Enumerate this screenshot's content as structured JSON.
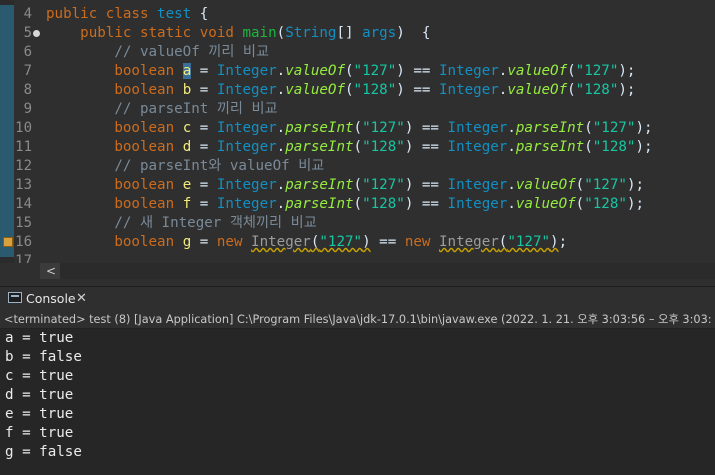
{
  "editor": {
    "lines": [
      {
        "num": "4",
        "tokens": [
          {
            "t": "public class ",
            "c": "kw"
          },
          {
            "t": "test ",
            "c": "ty"
          },
          {
            "t": "{",
            "c": ""
          }
        ]
      },
      {
        "num": "5",
        "fold": true,
        "tokens": [
          {
            "t": "    ",
            "c": ""
          },
          {
            "t": "public static void ",
            "c": "kw"
          },
          {
            "t": "main",
            "c": "fn"
          },
          {
            "t": "(",
            "c": ""
          },
          {
            "t": "String",
            "c": "tp"
          },
          {
            "t": "[] ",
            "c": ""
          },
          {
            "t": "args",
            "c": "tp"
          },
          {
            "t": ")  {",
            "c": ""
          }
        ]
      },
      {
        "num": "6",
        "tokens": [
          {
            "t": "        // valueOf 끼리 비교",
            "c": "cm"
          }
        ]
      },
      {
        "num": "7",
        "tokens": [
          {
            "t": "        ",
            "c": ""
          },
          {
            "t": "boolean ",
            "c": "kw"
          },
          {
            "t": "a",
            "c": "va sel"
          },
          {
            "t": " = ",
            "c": ""
          },
          {
            "t": "Integer",
            "c": "tp"
          },
          {
            "t": ".",
            "c": ""
          },
          {
            "t": "valueOf",
            "c": "mi"
          },
          {
            "t": "(",
            "c": ""
          },
          {
            "t": "\"127\"",
            "c": "st"
          },
          {
            "t": ") == ",
            "c": ""
          },
          {
            "t": "Integer",
            "c": "tp"
          },
          {
            "t": ".",
            "c": ""
          },
          {
            "t": "valueOf",
            "c": "mi"
          },
          {
            "t": "(",
            "c": ""
          },
          {
            "t": "\"127\"",
            "c": "st"
          },
          {
            "t": ");",
            "c": ""
          }
        ]
      },
      {
        "num": "8",
        "tokens": [
          {
            "t": "        ",
            "c": ""
          },
          {
            "t": "boolean ",
            "c": "kw"
          },
          {
            "t": "b",
            "c": "va"
          },
          {
            "t": " = ",
            "c": ""
          },
          {
            "t": "Integer",
            "c": "tp"
          },
          {
            "t": ".",
            "c": ""
          },
          {
            "t": "valueOf",
            "c": "mi"
          },
          {
            "t": "(",
            "c": ""
          },
          {
            "t": "\"128\"",
            "c": "st"
          },
          {
            "t": ") == ",
            "c": ""
          },
          {
            "t": "Integer",
            "c": "tp"
          },
          {
            "t": ".",
            "c": ""
          },
          {
            "t": "valueOf",
            "c": "mi"
          },
          {
            "t": "(",
            "c": ""
          },
          {
            "t": "\"128\"",
            "c": "st"
          },
          {
            "t": ");",
            "c": ""
          }
        ]
      },
      {
        "num": "9",
        "tokens": [
          {
            "t": "        // parseInt 끼리 비교",
            "c": "cm"
          }
        ]
      },
      {
        "num": "10",
        "tokens": [
          {
            "t": "        ",
            "c": ""
          },
          {
            "t": "boolean ",
            "c": "kw"
          },
          {
            "t": "c",
            "c": "va"
          },
          {
            "t": " = ",
            "c": ""
          },
          {
            "t": "Integer",
            "c": "tp"
          },
          {
            "t": ".",
            "c": ""
          },
          {
            "t": "parseInt",
            "c": "mi"
          },
          {
            "t": "(",
            "c": ""
          },
          {
            "t": "\"127\"",
            "c": "st"
          },
          {
            "t": ") == ",
            "c": ""
          },
          {
            "t": "Integer",
            "c": "tp"
          },
          {
            "t": ".",
            "c": ""
          },
          {
            "t": "parseInt",
            "c": "mi"
          },
          {
            "t": "(",
            "c": ""
          },
          {
            "t": "\"127\"",
            "c": "st"
          },
          {
            "t": ");",
            "c": ""
          }
        ]
      },
      {
        "num": "11",
        "tokens": [
          {
            "t": "        ",
            "c": ""
          },
          {
            "t": "boolean ",
            "c": "kw"
          },
          {
            "t": "d",
            "c": "va"
          },
          {
            "t": " = ",
            "c": ""
          },
          {
            "t": "Integer",
            "c": "tp"
          },
          {
            "t": ".",
            "c": ""
          },
          {
            "t": "parseInt",
            "c": "mi"
          },
          {
            "t": "(",
            "c": ""
          },
          {
            "t": "\"128\"",
            "c": "st"
          },
          {
            "t": ") == ",
            "c": ""
          },
          {
            "t": "Integer",
            "c": "tp"
          },
          {
            "t": ".",
            "c": ""
          },
          {
            "t": "parseInt",
            "c": "mi"
          },
          {
            "t": "(",
            "c": ""
          },
          {
            "t": "\"128\"",
            "c": "st"
          },
          {
            "t": ");",
            "c": ""
          }
        ]
      },
      {
        "num": "12",
        "tokens": [
          {
            "t": "        // parseInt와 valueOf 비교",
            "c": "cm"
          }
        ]
      },
      {
        "num": "13",
        "tokens": [
          {
            "t": "        ",
            "c": ""
          },
          {
            "t": "boolean ",
            "c": "kw"
          },
          {
            "t": "e",
            "c": "va"
          },
          {
            "t": " = ",
            "c": ""
          },
          {
            "t": "Integer",
            "c": "tp"
          },
          {
            "t": ".",
            "c": ""
          },
          {
            "t": "parseInt",
            "c": "mi"
          },
          {
            "t": "(",
            "c": ""
          },
          {
            "t": "\"127\"",
            "c": "st"
          },
          {
            "t": ") == ",
            "c": ""
          },
          {
            "t": "Integer",
            "c": "tp"
          },
          {
            "t": ".",
            "c": ""
          },
          {
            "t": "valueOf",
            "c": "mi"
          },
          {
            "t": "(",
            "c": ""
          },
          {
            "t": "\"127\"",
            "c": "st"
          },
          {
            "t": ");",
            "c": ""
          }
        ]
      },
      {
        "num": "14",
        "tokens": [
          {
            "t": "        ",
            "c": ""
          },
          {
            "t": "boolean ",
            "c": "kw"
          },
          {
            "t": "f",
            "c": "va"
          },
          {
            "t": " = ",
            "c": ""
          },
          {
            "t": "Integer",
            "c": "tp"
          },
          {
            "t": ".",
            "c": ""
          },
          {
            "t": "parseInt",
            "c": "mi"
          },
          {
            "t": "(",
            "c": ""
          },
          {
            "t": "\"128\"",
            "c": "st"
          },
          {
            "t": ") == ",
            "c": ""
          },
          {
            "t": "Integer",
            "c": "tp"
          },
          {
            "t": ".",
            "c": ""
          },
          {
            "t": "valueOf",
            "c": "mi"
          },
          {
            "t": "(",
            "c": ""
          },
          {
            "t": "\"128\"",
            "c": "st"
          },
          {
            "t": ");",
            "c": ""
          }
        ]
      },
      {
        "num": "15",
        "tokens": [
          {
            "t": "        // 새 Integer 객체끼리 비교",
            "c": "cm"
          }
        ]
      },
      {
        "num": "16",
        "warning": true,
        "tokens": [
          {
            "t": "        ",
            "c": ""
          },
          {
            "t": "boolean ",
            "c": "kw"
          },
          {
            "t": "g",
            "c": "va"
          },
          {
            "t": " = ",
            "c": ""
          },
          {
            "t": "new ",
            "c": "kw"
          },
          {
            "t": "Integer",
            "c": "depr warn"
          },
          {
            "t": "(",
            "c": "warn"
          },
          {
            "t": "\"127\"",
            "c": "st warn"
          },
          {
            "t": ")",
            "c": "warn"
          },
          {
            "t": " == ",
            "c": ""
          },
          {
            "t": "new ",
            "c": "kw"
          },
          {
            "t": "Integer",
            "c": "depr warn"
          },
          {
            "t": "(",
            "c": "warn"
          },
          {
            "t": "\"127\"",
            "c": "st warn"
          },
          {
            "t": ")",
            "c": "warn"
          },
          {
            "t": ";",
            "c": ""
          }
        ]
      },
      {
        "num": "17",
        "tokens": []
      }
    ]
  },
  "scrollbar": {
    "left_arrow": "<"
  },
  "console": {
    "tab_label": "Console",
    "tab_close": "✕",
    "header": "<terminated> test (8) [Java Application] C:\\Program Files\\Java\\jdk-17.0.1\\bin\\javaw.exe  (2022. 1. 21. 오후 3:03:56 – 오후 3:03:",
    "output": [
      "a = true",
      "b = false",
      "c = true",
      "d = true",
      "e = true",
      "f = true",
      "g = false"
    ]
  },
  "icons": {
    "console": "console-icon",
    "close": "close-icon",
    "warning": "quick-fix-warning-icon",
    "fold": "fold-collapse-icon"
  }
}
